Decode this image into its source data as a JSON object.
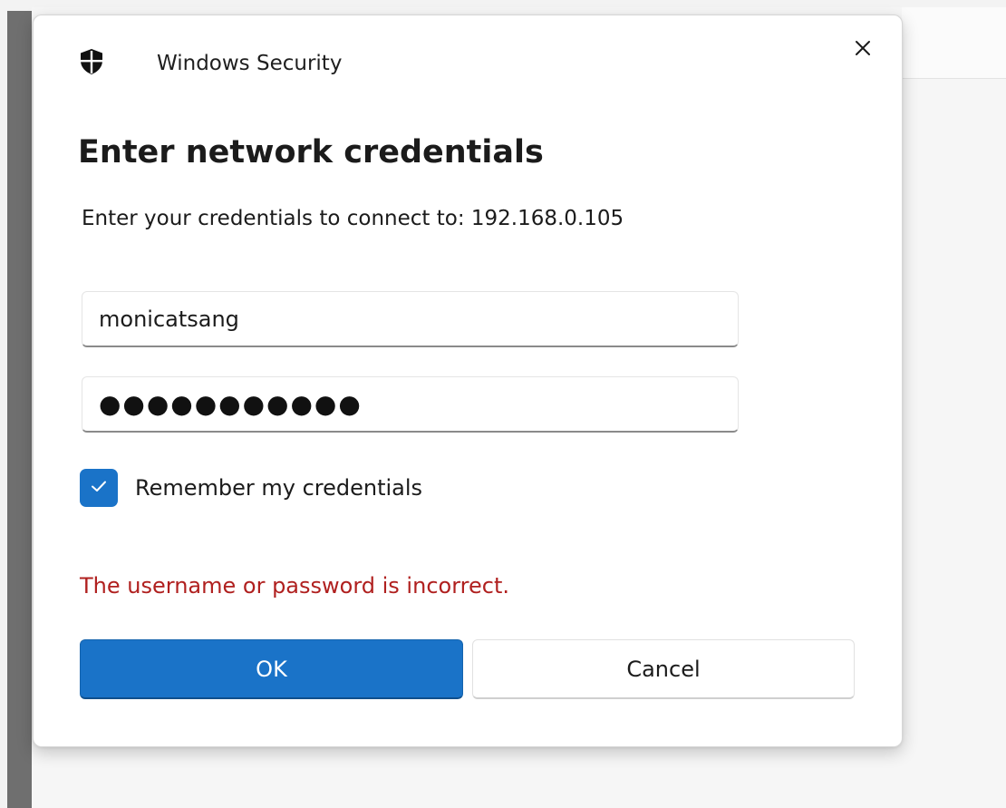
{
  "window": {
    "title": "Windows Security",
    "icon": "shield-icon",
    "close_icon": "close-icon"
  },
  "dialog": {
    "heading": "Enter network credentials",
    "prompt": "Enter your credentials to connect to: 192.168.0.105"
  },
  "fields": {
    "username_value": "monicatsang",
    "password_masked": "●●●●●●●●●●●",
    "password_length": 11
  },
  "remember": {
    "label": "Remember my credentials",
    "checked": true
  },
  "error": {
    "message": "The username or password is incorrect.",
    "color": "#b0201f"
  },
  "buttons": {
    "ok_label": "OK",
    "cancel_label": "Cancel"
  },
  "theme": {
    "accent": "#1a73c8"
  }
}
